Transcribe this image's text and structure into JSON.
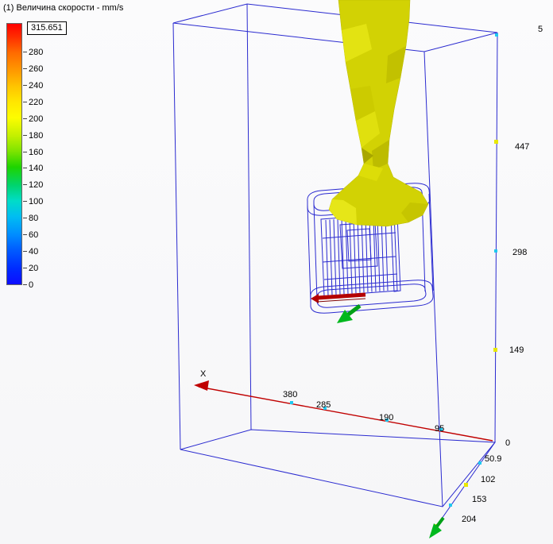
{
  "legend": {
    "title": "(1) Величина скорости - mm/s",
    "max_value": "315.651",
    "ticks": [
      "280",
      "260",
      "240",
      "220",
      "200",
      "180",
      "160",
      "140",
      "120",
      "100",
      "80",
      "60",
      "40",
      "20",
      "0"
    ],
    "colors": {
      "max": "#ff0000",
      "min": "#0d0dff"
    }
  },
  "viewport": {
    "wireframe_color": "#2b2bd0",
    "isosurface_color": "#d2d204",
    "axes": {
      "x_label": "X",
      "x_color": "#c00000",
      "y_color": "#00a018",
      "z_color": "#2b2bd0"
    },
    "rulers": {
      "x_ticks": [
        "380",
        "285",
        "190",
        "95"
      ],
      "z_ticks": [
        "5",
        "447",
        "298",
        "149",
        "0"
      ],
      "y_ticks": [
        "50.9",
        "102",
        "153",
        "204"
      ]
    }
  }
}
